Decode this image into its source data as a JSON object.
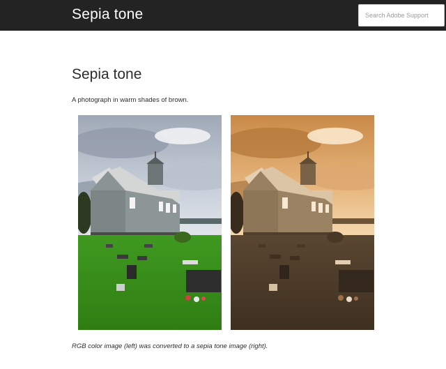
{
  "header": {
    "brand": "Sepia tone",
    "search_placeholder": "Search Adobe Support"
  },
  "article": {
    "title": "Sepia tone",
    "lead": "A photograph in warm shades of brown.",
    "caption": "RGB color image (left) was converted to a sepia tone image (right)."
  },
  "images": {
    "left": {
      "variant": "color"
    },
    "right": {
      "variant": "sepia"
    }
  },
  "colors": {
    "header_bg": "#232323",
    "header_text": "#ffffff",
    "body_text": "#2c2c2c"
  }
}
